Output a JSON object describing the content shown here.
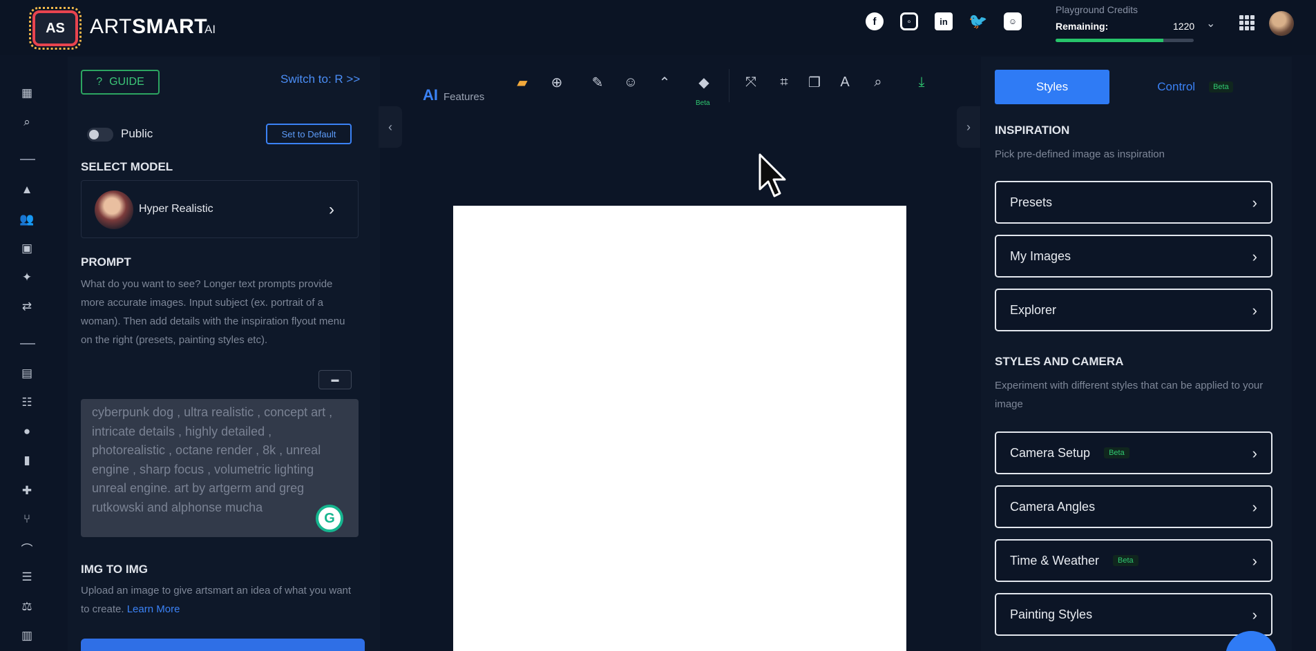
{
  "header": {
    "logo": "AS",
    "brand_main": "ART",
    "brand_bold": "SMART",
    "brand_suffix": "AI",
    "social_icons": [
      "facebook-icon",
      "instagram-icon",
      "linkedin-icon",
      "twitter-icon",
      "discord-icon"
    ],
    "credits_label": "Playground Credits",
    "remaining_label": "Remaining:",
    "remaining_value": "1220",
    "credits_fraction": 0.78
  },
  "rail_icons": [
    "grid-icon",
    "search-icon",
    "shapes-icon",
    "users-icon",
    "portrait-icon",
    "magic-wand-icon",
    "swap-icon",
    "document-icon",
    "community-icon",
    "user-icon",
    "book-icon",
    "puzzle-icon",
    "branch-icon",
    "bridge-icon",
    "list-icon",
    "scale-icon",
    "chart-icon"
  ],
  "left": {
    "guide_label": "GUIDE",
    "switch_label": "Switch to: R >>",
    "public_label": "Public",
    "default_label": "Set to Default",
    "select_model_title": "SELECT MODEL",
    "model_name": "Hyper Realistic",
    "prompt_title": "PROMPT",
    "prompt_help": "What do you want to see? Longer text prompts provide more accurate images. Input subject (ex. portrait of a woman). Then add details with the inspiration flyout menu on the right (presets, painting styles etc).",
    "prompt_value": "cyberpunk dog , ultra realistic , concept art , intricate details , highly detailed , photorealistic , octane render , 8k , unreal engine , sharp focus , volumetric lighting unreal engine. art by artgerm and greg rutkowski and alphonse mucha",
    "img2img_title": "IMG TO IMG",
    "img2img_help": "Upload an image to give artsmart an idea of what you want to create.",
    "learn_more": "Learn More"
  },
  "toolbar": {
    "ai_label": "AI",
    "features_label": "Features",
    "beta_label": "Beta",
    "tools": [
      "folder-open-icon",
      "plus-circle-icon",
      "edit-icon",
      "smile-icon",
      "upscale-icon",
      "eraser-icon",
      "expand-icon",
      "crop-icon",
      "layers-icon",
      "text-icon",
      "zoom-icon",
      "download-icon"
    ]
  },
  "right": {
    "tab_styles": "Styles",
    "tab_control": "Control",
    "tab_control_badge": "Beta",
    "inspiration_title": "INSPIRATION",
    "inspiration_help": "Pick pre-defined image as inspiration",
    "inspiration_options": [
      {
        "label": "Presets",
        "badge": ""
      },
      {
        "label": "My Images",
        "badge": ""
      },
      {
        "label": "Explorer",
        "badge": ""
      }
    ],
    "styles_title": "STYLES AND CAMERA",
    "styles_help": "Experiment with different styles that can be applied to your image",
    "style_options": [
      {
        "label": "Camera Setup",
        "badge": "Beta"
      },
      {
        "label": "Camera Angles",
        "badge": ""
      },
      {
        "label": "Time & Weather",
        "badge": "Beta"
      },
      {
        "label": "Painting Styles",
        "badge": ""
      }
    ]
  },
  "colors": {
    "accent": "#2f7bf5",
    "beta": "#2fc971",
    "background": "#0c1526",
    "logo_border": "#e8444f"
  }
}
